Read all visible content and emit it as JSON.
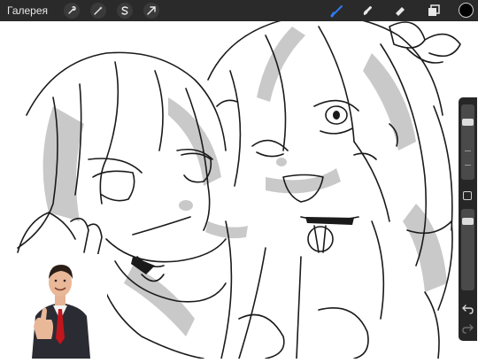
{
  "topbar": {
    "gallery_label": "Галерея",
    "left_tools": [
      "wrench-icon",
      "magic-wand-icon",
      "selection-s-icon",
      "move-arrow-icon"
    ],
    "right_tools": [
      "brush-icon",
      "smudge-icon",
      "eraser-icon",
      "layers-icon"
    ],
    "active_tool": "brush-icon",
    "accent_color": "#2f7bf5",
    "current_color": "#000000"
  },
  "sidebar": {
    "controls": [
      "brush-size-slider",
      "modify-button",
      "opacity-slider",
      "undo-icon",
      "redo-icon"
    ]
  }
}
